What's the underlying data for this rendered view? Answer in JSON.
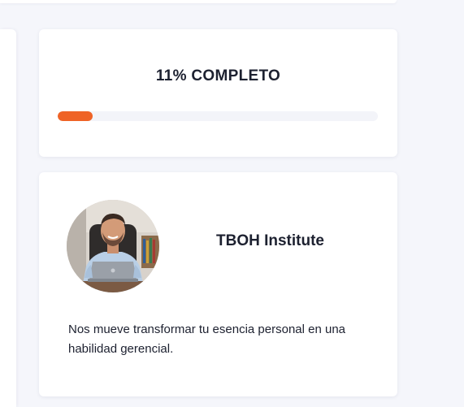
{
  "progress": {
    "label": "11% COMPLETO",
    "percent": 11,
    "accent_color": "#ef6326"
  },
  "author": {
    "name": "TBOH Institute",
    "bio": "Nos mueve transformar tu esencia personal en una habilidad gerencial.",
    "avatar_icon": "instructor-photo"
  }
}
